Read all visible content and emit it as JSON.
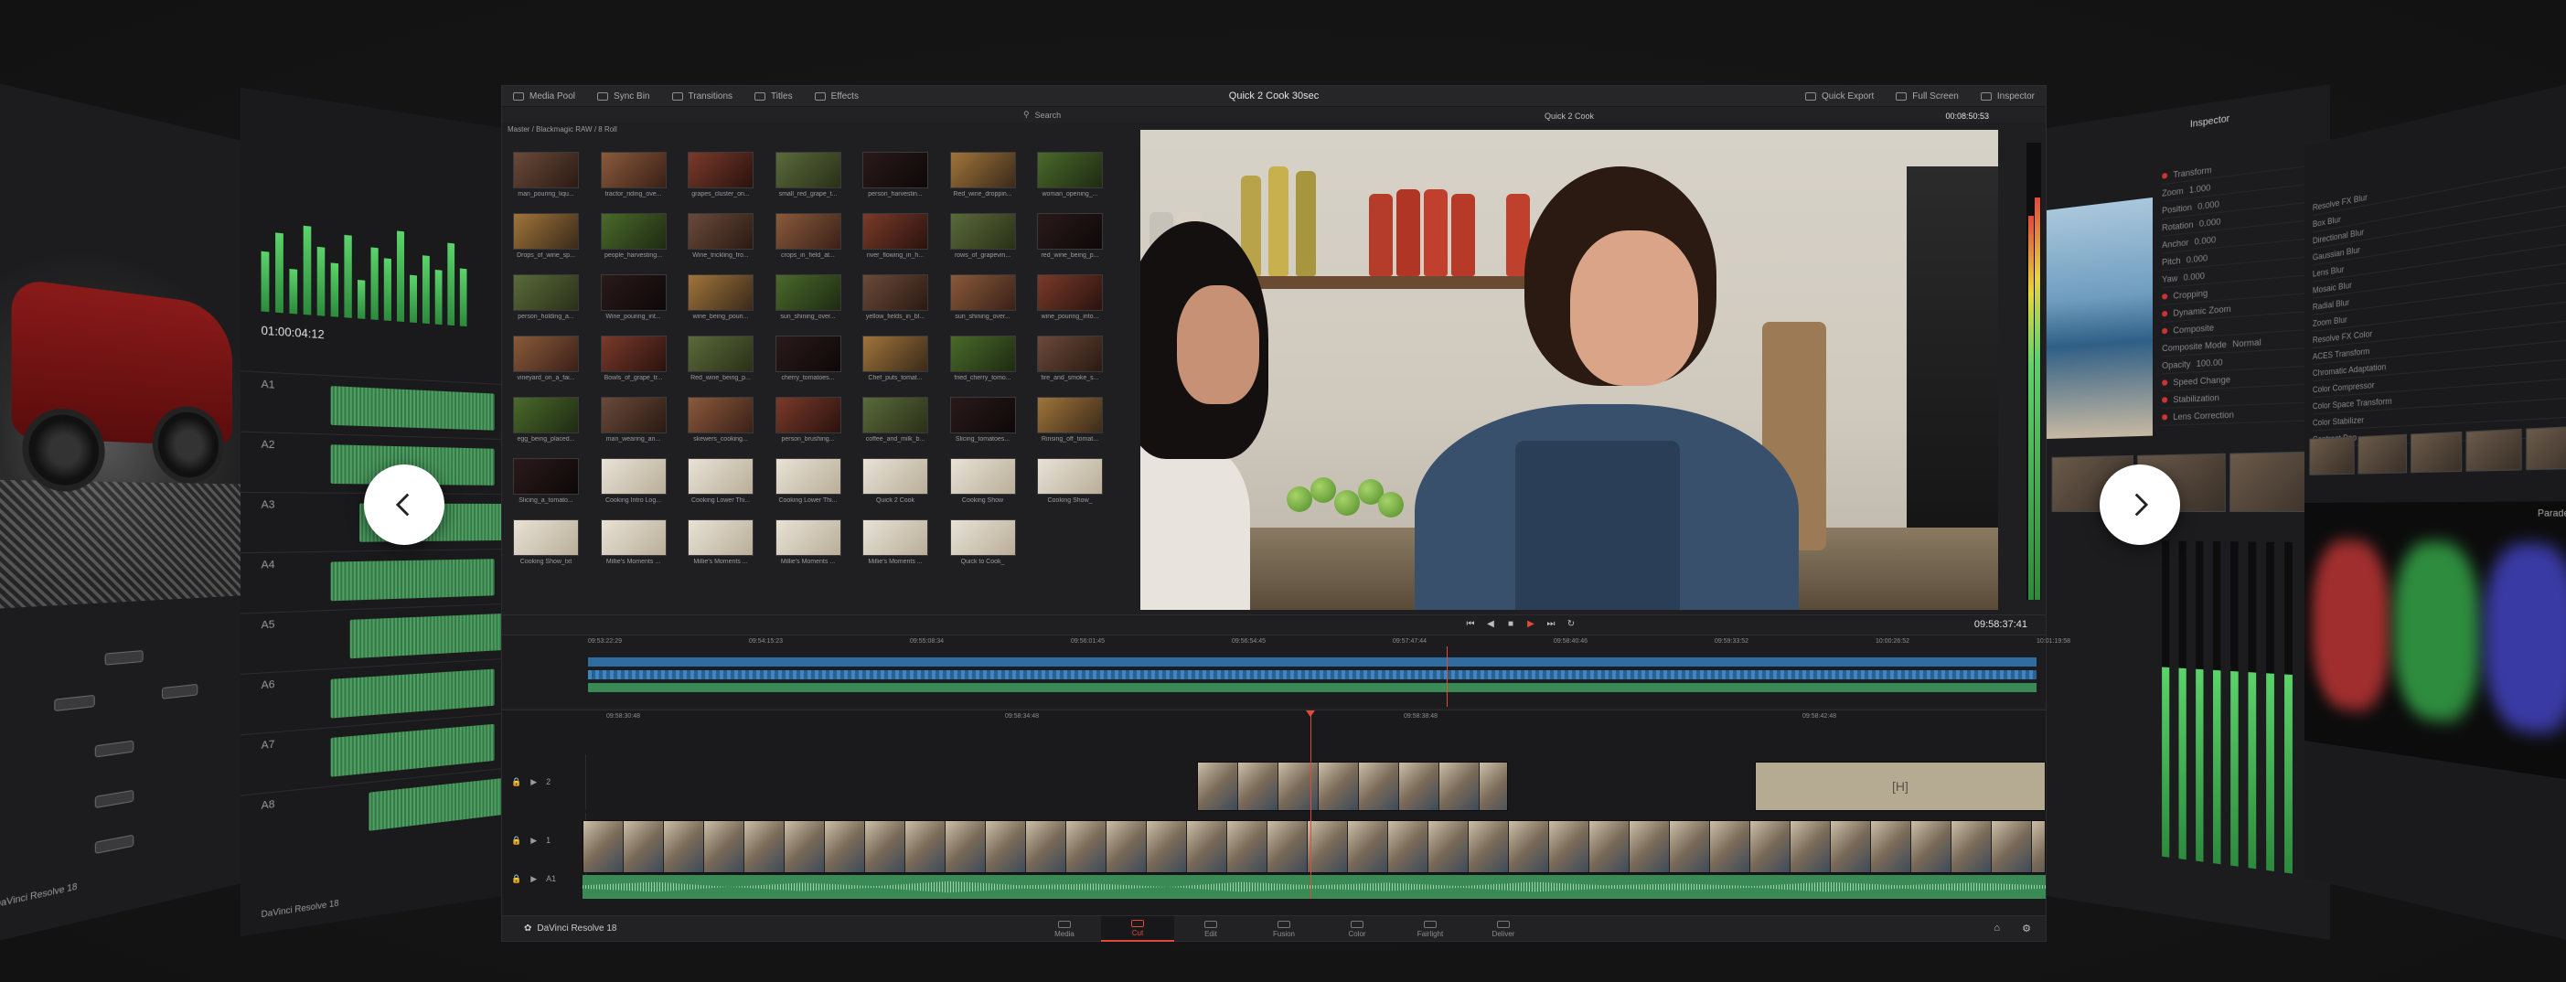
{
  "app": {
    "project_title": "Quick 2 Cook 30sec",
    "brand_name": "DaVinci Resolve 18"
  },
  "topbar": {
    "left_items": [
      {
        "label": "Media Pool",
        "icon": "media-pool-icon"
      },
      {
        "label": "Sync Bin",
        "icon": "sync-bin-icon"
      },
      {
        "label": "Transitions",
        "icon": "transitions-icon"
      },
      {
        "label": "Titles",
        "icon": "titles-icon"
      },
      {
        "label": "Effects",
        "icon": "effects-icon"
      }
    ],
    "right_items": [
      {
        "label": "Quick Export",
        "icon": "export-icon"
      },
      {
        "label": "Full Screen",
        "icon": "fullscreen-icon"
      },
      {
        "label": "Inspector",
        "icon": "inspector-icon"
      }
    ]
  },
  "media_pool": {
    "search_label": "Search",
    "path": "Master / Blackmagic RAW / 8 Roll",
    "clips": [
      "man_pouring_liqu...",
      "tractor_riding_ove...",
      "grapes_cluster_on...",
      "small_red_grape_t...",
      "person_harvestin...",
      "Red_wine_droppin...",
      "woman_opening_...",
      "Drops_of_wine_sp...",
      "people_harvesting...",
      "Wine_trickling_fro...",
      "crops_in_field_at...",
      "river_flowing_in_h...",
      "rows_of_grapevin...",
      "red_wine_being_p...",
      "person_holding_a...",
      "Wine_pouring_int...",
      "wine_being_pouri...",
      "sun_shining_over...",
      "yellow_fields_in_bl...",
      "sun_shining_over...",
      "wine_pouring_into...",
      "vineyard_on_a_fai...",
      "Bowls_of_grape_tr...",
      "Red_wine_being_p...",
      "cherry_tomatoes...",
      "Chef_puts_tomat...",
      "fried_cherry_tomo...",
      "fire_and_smoke_s...",
      "egg_being_placed...",
      "man_wearing_an...",
      "skewers_cooking...",
      "person_brushing...",
      "coffee_and_milk_b...",
      "Slicing_tomatoes...",
      "Rinsing_off_tomat...",
      "Slicing_a_tomato...",
      "Cooking Intro Log...",
      "Cooking Lower Thi...",
      "Cooking Lower Thi...",
      "Quick 2 Cook",
      "Cooking Show",
      "Cooking Show_",
      "Cooking Show_txt",
      "Millie's Moments ...",
      "Millie's Moments ...",
      "Millie's Moments ...",
      "Millie's Moments ...",
      "Quick to Cook_"
    ]
  },
  "viewer": {
    "clip_name": "Quick 2 Cook",
    "duration_tc": "00:08:50:53",
    "current_tc": "09:58:37:41"
  },
  "overview_ruler": [
    "09:53:22:29",
    "09:54:15:23",
    "09:55:08:34",
    "09:56:01:45",
    "09:56:54:45",
    "09:57:47:44",
    "09:58:40:46",
    "09:59:33:52",
    "10:00:26:52",
    "10:01:19:58"
  ],
  "timeline_ruler": [
    "09:58:30:48",
    "09:58:34:48",
    "09:58:38:48",
    "09:58:42:48"
  ],
  "tracks": [
    {
      "id": "V2",
      "num": "2"
    },
    {
      "id": "V1",
      "num": "1"
    },
    {
      "id": "A1",
      "num": "A1"
    }
  ],
  "pages": [
    {
      "label": "Media",
      "icon": "media-page-icon"
    },
    {
      "label": "Cut",
      "icon": "cut-page-icon",
      "active": true
    },
    {
      "label": "Edit",
      "icon": "edit-page-icon"
    },
    {
      "label": "Fusion",
      "icon": "fusion-page-icon"
    },
    {
      "label": "Color",
      "icon": "color-page-icon"
    },
    {
      "label": "Fairlight",
      "icon": "fairlight-page-icon"
    },
    {
      "label": "Deliver",
      "icon": "deliver-page-icon"
    }
  ],
  "side_panels": {
    "left_near_timecode": "01:00:04:12",
    "left_far_label": "DaVinci Resolve 18",
    "left_near_label": "DaVinci Resolve 18",
    "right_near_title": "Inspector",
    "right_far_title": "Parade"
  },
  "colors": {
    "accent": "#e04a3a",
    "audio_clip": "#3a8a56",
    "panel_bg": "#1f1f21"
  }
}
